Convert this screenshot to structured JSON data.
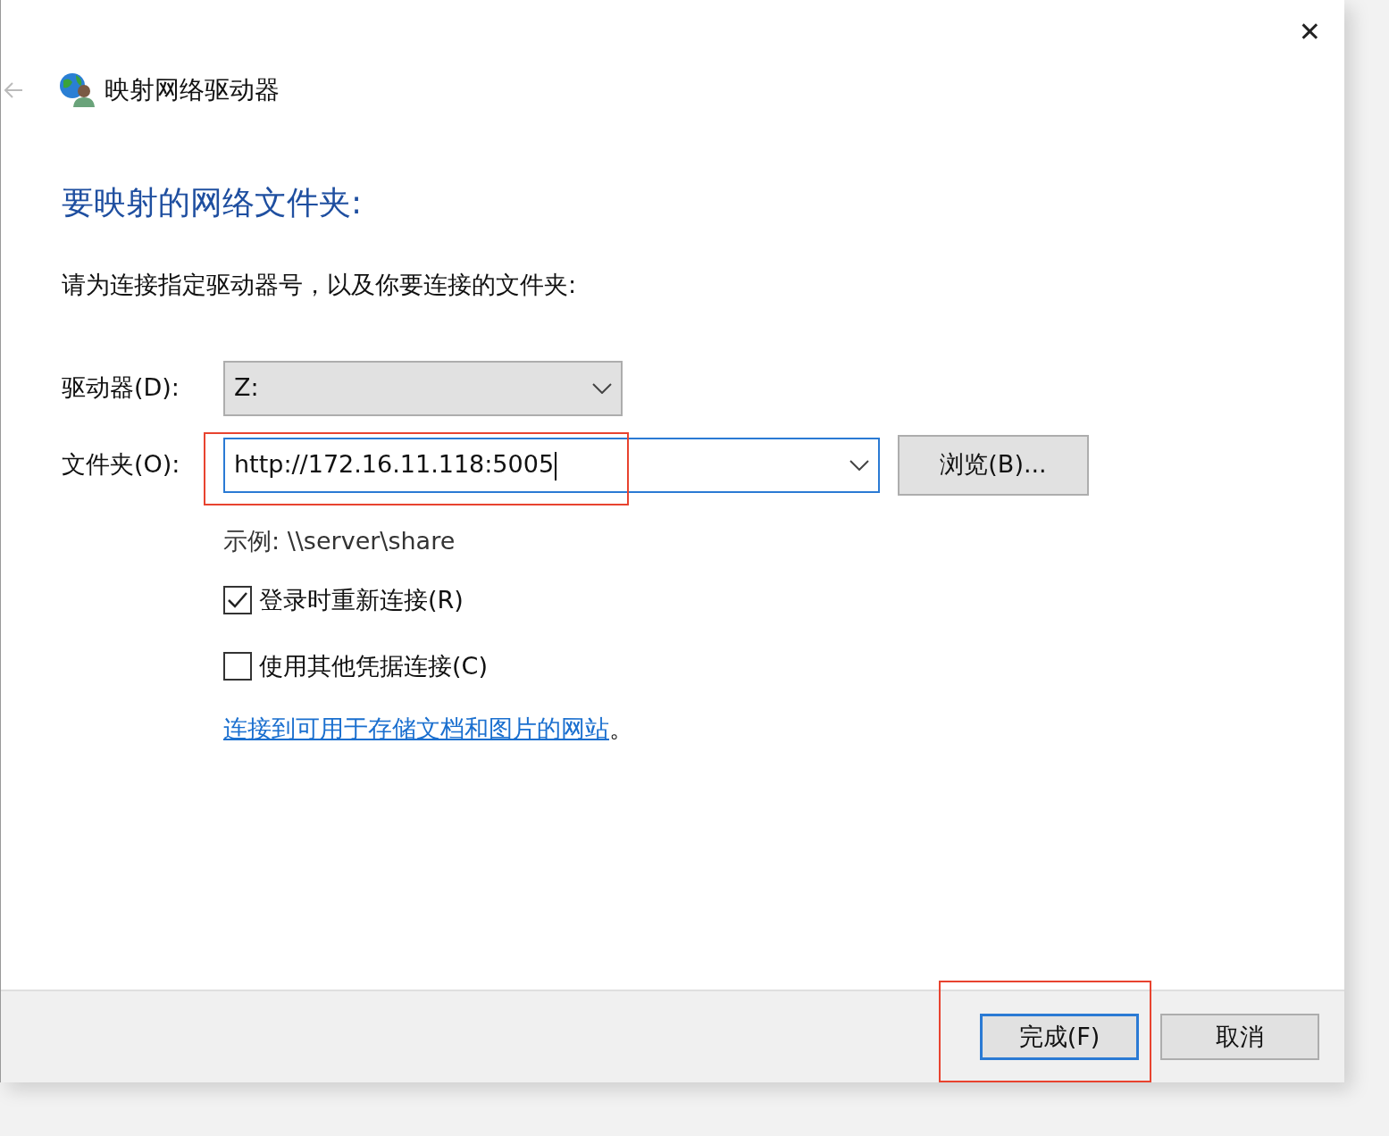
{
  "window": {
    "title": "映射网络驱动器",
    "close": "✕"
  },
  "heading": "要映射的网络文件夹:",
  "instruction": "请为连接指定驱动器号，以及你要连接的文件夹:",
  "drive": {
    "label": "驱动器(D):",
    "value": "Z:"
  },
  "folder": {
    "label": "文件夹(O):",
    "value": "http://172.16.11.118:5005",
    "focused": true,
    "browse": "浏览(B)..."
  },
  "example": "示例: \\\\server\\share",
  "checkboxes": [
    {
      "label": "登录时重新连接(R)",
      "checked": true
    },
    {
      "label": "使用其他凭据连接(C)",
      "checked": false
    }
  ],
  "link": {
    "text": "连接到可用于存储文档和图片的网站",
    "suffix": "。"
  },
  "buttons": [
    {
      "label": "完成(F)",
      "default": true
    },
    {
      "label": "取消",
      "default": false
    }
  ]
}
